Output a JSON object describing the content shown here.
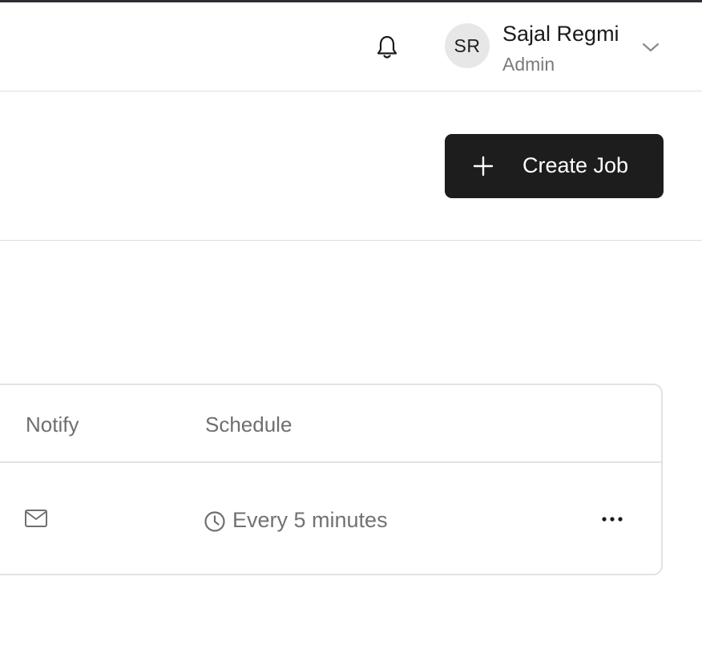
{
  "user": {
    "initials": "SR",
    "name": "Sajal Regmi",
    "role": "Admin"
  },
  "toolbar": {
    "create_label": "Create Job"
  },
  "table": {
    "columns": [
      "Notify",
      "Schedule"
    ],
    "rows": [
      {
        "notify_icon": "mail-icon",
        "schedule": "Every 5 minutes"
      }
    ]
  },
  "icons": {
    "notifications": "bell-icon",
    "user_menu": "chevron-down-icon",
    "create": "plus-icon",
    "schedule": "clock-icon",
    "row_actions": "more-horizontal-icon"
  },
  "colors": {
    "primary_button": "#1d1d1d",
    "border": "#e2e2e2",
    "muted_text": "#727272"
  }
}
